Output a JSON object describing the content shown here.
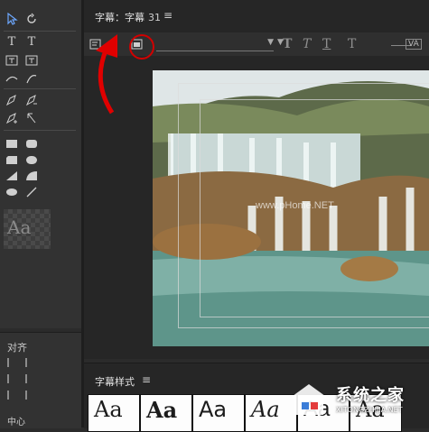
{
  "title_panel": {
    "tab_label": "字幕：字幕",
    "tab_number": "31",
    "menu_icon": "hamburger-icon",
    "toolbar": {
      "bold_glyph": "T",
      "italic_glyph": "T",
      "underline_glyph": "T",
      "kerning_glyph": "T",
      "kerning_label": "VA"
    }
  },
  "tools_panel": {
    "aa_preview": "Aa"
  },
  "align_panel": {
    "title": "对齐",
    "center_label": "中心"
  },
  "styles_panel": {
    "title": "字幕样式",
    "swatches": [
      "Aa",
      "Aa",
      "Aa",
      "Aa",
      "Aa",
      "Aa"
    ]
  },
  "canvas": {
    "watermark": "www.pHome.NET"
  },
  "logo": {
    "name": "系统之家",
    "url": "XITONGZHIJIA.NET"
  },
  "colors": {
    "annotation_red": "#d10000",
    "panel_bg": "#262626"
  }
}
